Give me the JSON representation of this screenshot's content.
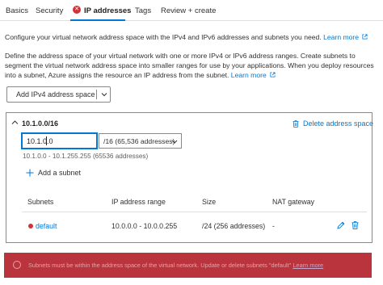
{
  "tabs": [
    {
      "label": "Basics",
      "active": false
    },
    {
      "label": "Security",
      "active": false
    },
    {
      "label": "IP addresses",
      "active": true,
      "has_error": true
    },
    {
      "label": "Tags",
      "active": false
    },
    {
      "label": "Review + create",
      "active": false
    }
  ],
  "intro": {
    "text": "Configure your virtual network address space with the IPv4 and IPv6 addresses and subnets you need.",
    "link": "Learn more"
  },
  "description": {
    "text": "Define the address space of your virtual network with one or more IPv4 or IPv6 address ranges. Create subnets to segment the virtual network address space into smaller ranges for use by your applications. When you deploy resources into a subnet, Azure assigns the resource an IP address from the subnet.",
    "link": "Learn more"
  },
  "add_space_button": {
    "label": "Add IPv4 address space",
    "icon": "chevron-down-icon"
  },
  "address_space": {
    "title": "10.1.0.0/16",
    "delete_label": "Delete address space",
    "address_value": "10.1.0.0",
    "prefix_value": "/16 (65,536 addresses)",
    "range_text": "10.1.0.0 - 10.1.255.255 (65536 addresses)",
    "add_subnet_label": "Add a subnet"
  },
  "subnets_table": {
    "columns": [
      "Subnets",
      "IP address range",
      "Size",
      "NAT gateway"
    ],
    "rows": [
      {
        "name": "default",
        "range": "10.0.0.0 - 10.0.0.255",
        "size": "/24 (256 addresses)",
        "nat": "-",
        "has_error": true
      }
    ]
  },
  "error_banner": {
    "text": "Subnets must be within the address space of the virtual network. Update or delete subnets \"default\"",
    "link": "Learn more"
  },
  "colors": {
    "accent": "#0078d4",
    "error": "#d13438",
    "banner": "#b9343d"
  }
}
